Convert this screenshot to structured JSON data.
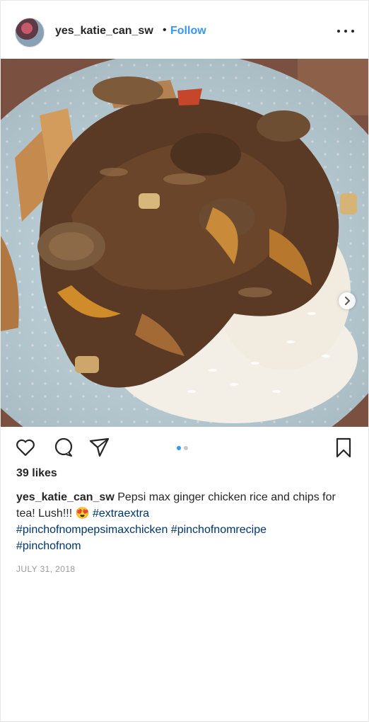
{
  "header": {
    "username": "yes_katie_can_sw",
    "separator": "•",
    "follow_label": "Follow",
    "more_icon": "more-horizontal-icon"
  },
  "photo": {
    "alt": "Pepsi max ginger chicken rice and chips",
    "carousel_index": 1,
    "carousel_count": 2
  },
  "actions": {
    "icons": [
      "heart-icon",
      "comment-icon",
      "share-icon",
      "bookmark-icon"
    ]
  },
  "likes": "39 likes",
  "caption": {
    "user": "yes_katie_can_sw",
    "text_line1": " Pepsi max ginger chicken rice and chips for tea! Lush!!! ",
    "emoji": "😍",
    "tag1": "#extraextra",
    "tag2": "#pinchofnompepsimaxchicken",
    "tag3": "#pinchofnomrecipe",
    "tag4": "#pinchofnom"
  },
  "date": "JULY 31, 2018",
  "colors": {
    "follow": "#3897f0",
    "hashtag": "#003569",
    "date": "#999999",
    "active_dot": "#3897f0",
    "inactive_dot": "#c7c7c7"
  }
}
